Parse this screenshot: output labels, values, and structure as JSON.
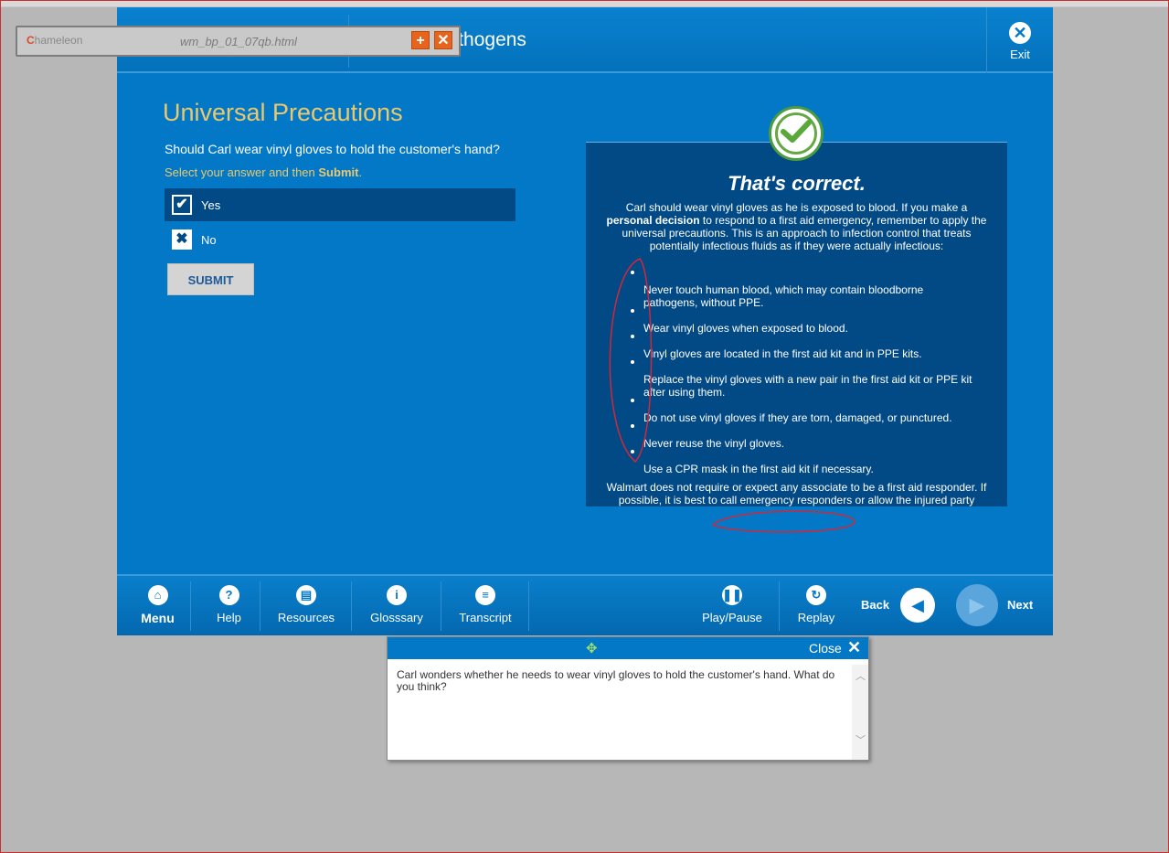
{
  "header": {
    "course_title": "e Pathogens",
    "exit_label": "Exit"
  },
  "chameleon": {
    "logo": "hameleon",
    "logo_initial": "C",
    "file_name": "wm_bp_01_07qb.html",
    "add_icon": "plus-icon",
    "close_icon": "close-icon"
  },
  "question_panel": {
    "title": "Universal Precautions",
    "question": "Should Carl wear vinyl gloves to hold the customer's hand?",
    "instruction_prefix": "Select your answer and then ",
    "instruction_bold": "Submit",
    "instruction_suffix": ".",
    "options": [
      {
        "label": "Yes",
        "selected": true,
        "mark": "✔"
      },
      {
        "label": "No",
        "selected": false,
        "mark": "✖"
      }
    ],
    "submit_label": "SUBMIT"
  },
  "feedback": {
    "title": "That's correct.",
    "intro_1": "Carl should wear vinyl gloves as he is exposed to blood.  If you make a ",
    "intro_bold": "personal decision",
    "intro_2": " to respond to a first aid emergency, remember to apply the universal precautions.  This is an approach to infection control that treats potentially infectious fluids as if they were actually infectious:",
    "bullets": [
      "Never touch human blood, which may contain bloodborne pathogens, without PPE.",
      "Wear vinyl gloves when exposed to blood.",
      "Vinyl gloves are located in the first aid kit and in PPE kits.",
      "Replace the vinyl gloves with a new pair in the first aid kit or PPE kit after using them.",
      "Do not use vinyl gloves if they are torn, damaged, or punctured.",
      "Never reuse the vinyl gloves.",
      "Use a CPR mask in the first aid kit if necessary."
    ],
    "footer": "Walmart does not require or expect any associate to be a first aid responder. If possible, it is best to call emergency responders or allow the injured party"
  },
  "toolbar": {
    "menu": "Menu",
    "help": "Help",
    "resources": "Resources",
    "glossary": "Glosssary",
    "transcript": "Transcript",
    "play_pause": "Play/Pause",
    "replay": "Replay",
    "back": "Back",
    "next": "Next"
  },
  "transcript_popup": {
    "close_label": "Close",
    "text": "Carl wonders whether he needs to wear vinyl gloves to hold the customer's hand.  What do you think?"
  },
  "colors": {
    "player_blue": "#0378c6",
    "panel_dark": "#024a85",
    "title_gold": "#e9c86e",
    "annotation_red": "#d0283a"
  }
}
